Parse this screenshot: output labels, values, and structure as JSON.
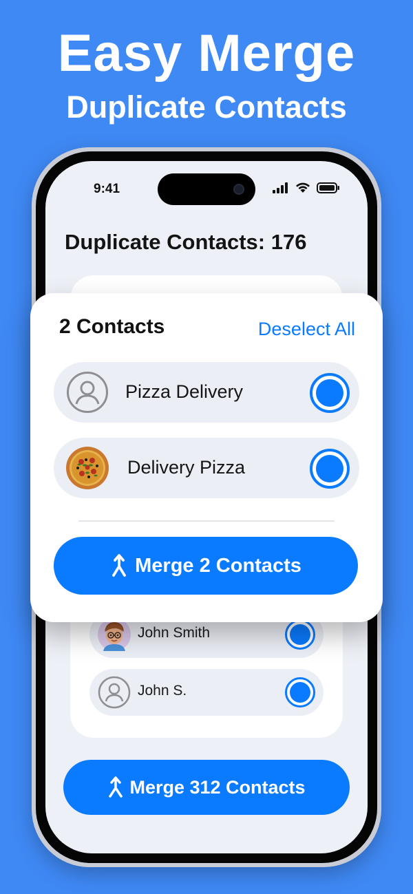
{
  "banner": {
    "headline": "Easy Merge",
    "subheadline": "Duplicate Contacts"
  },
  "status_bar": {
    "time": "9:41",
    "icons": [
      "signal-icon",
      "wifi-icon",
      "battery-icon"
    ]
  },
  "screen": {
    "title": "Duplicate Contacts: 176"
  },
  "popup": {
    "count_label": "2 Contacts",
    "deselect_label": "Deselect All",
    "contacts": [
      {
        "name": "Pizza Delivery",
        "avatar": "person-placeholder-icon",
        "selected": true
      },
      {
        "name": "Delivery Pizza",
        "avatar": "pizza-photo",
        "selected": true
      }
    ],
    "merge_label": "Merge 2 Contacts",
    "merge_icon": "merge-arrow-icon"
  },
  "group": {
    "contacts": [
      {
        "name": "John Smith",
        "avatar": "memoji-avatar",
        "selected": true
      },
      {
        "name": "John S.",
        "avatar": "person-placeholder-icon",
        "selected": true
      }
    ]
  },
  "footer": {
    "merge_all_label": "Merge 312 Contacts"
  },
  "colors": {
    "background": "#3f89f5",
    "accent": "#0a7bff",
    "row_background": "#eceef6",
    "screen_background": "#eef0f7"
  }
}
